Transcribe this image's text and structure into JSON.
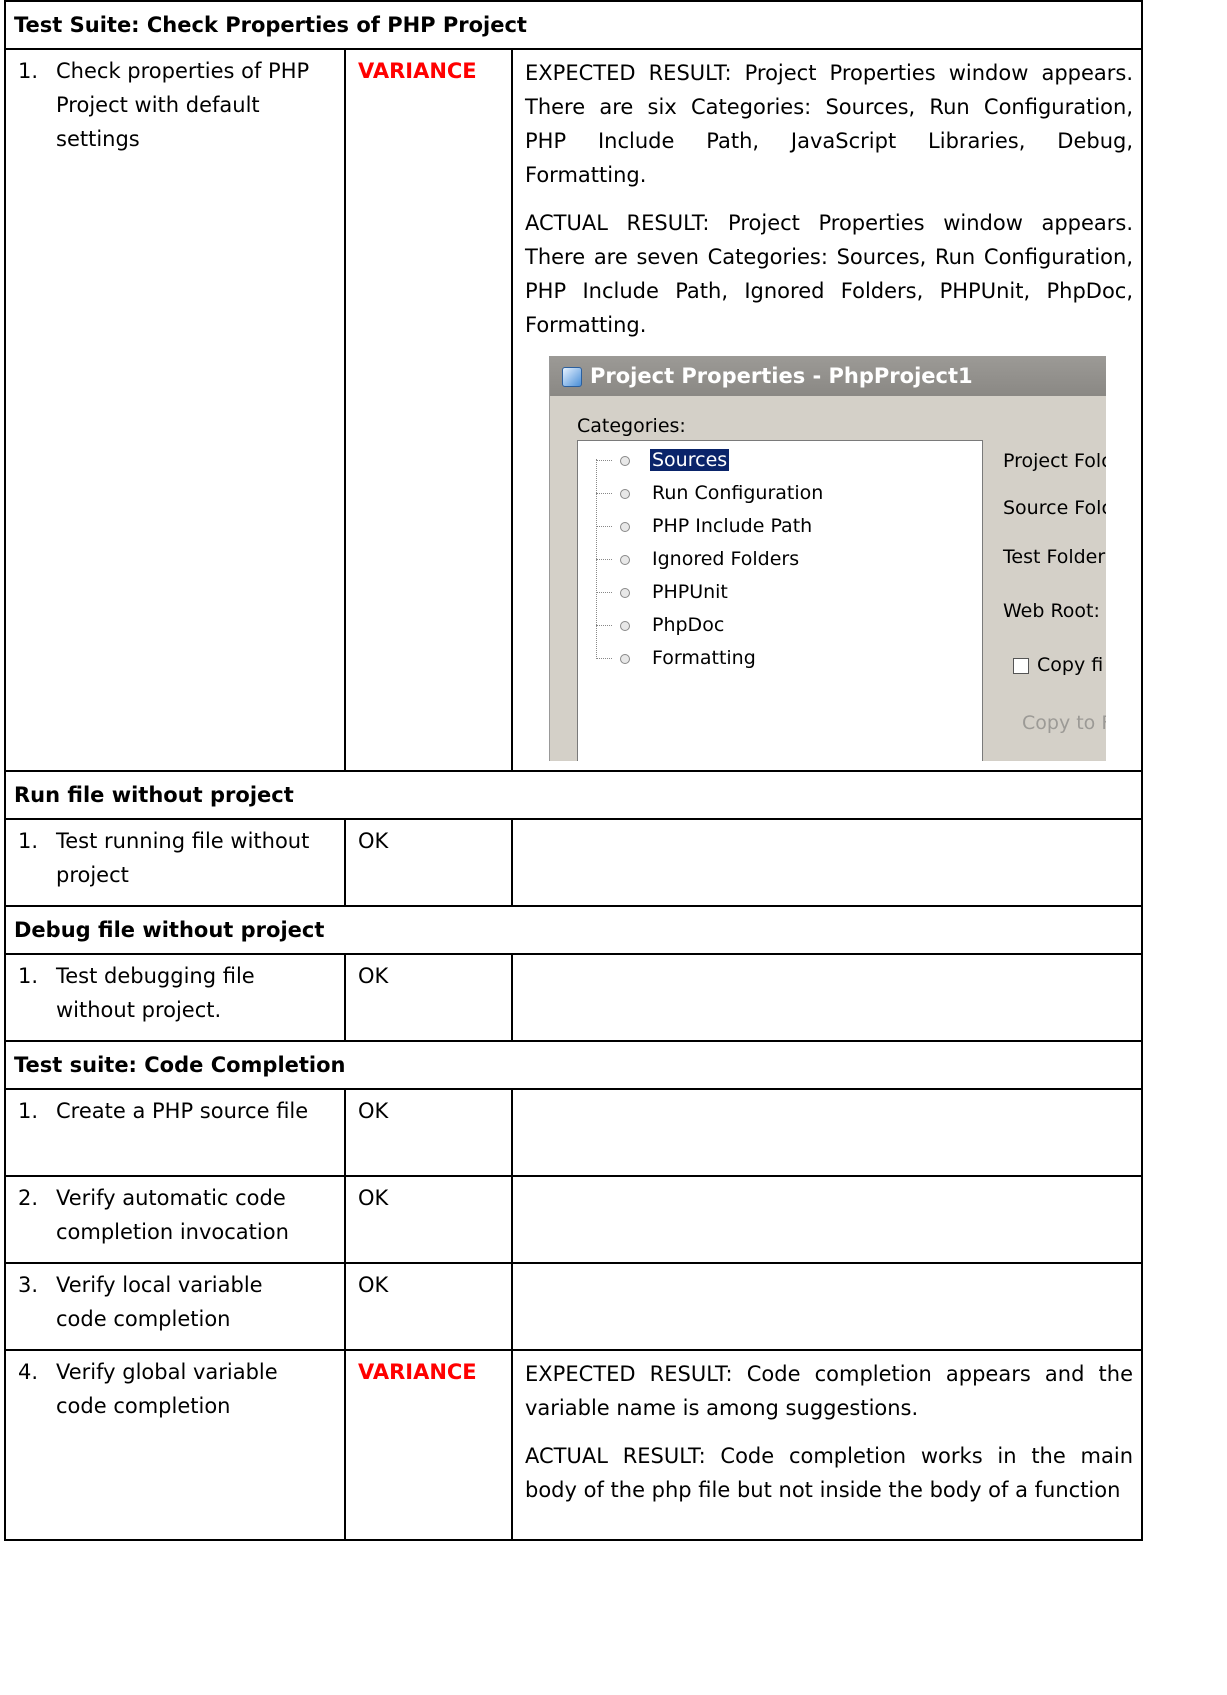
{
  "sections": [
    {
      "title": "Test Suite: Check Properties of PHP Project",
      "rows": [
        {
          "num": "1.",
          "step": "Check properties of PHP Project with default settings",
          "status": "VARIANCE",
          "paragraphs": [
            "EXPECTED RESULT: Project Properties window appears. There are six Categories: Sources, Run Configuration, PHP Include Path, JavaScript Libraries, Debug, Formatting.",
            "ACTUAL RESULT: Project Properties window appears. There are seven Categories: Sources, Run Configuration, PHP Include Path, Ignored Folders, PHPUnit, PhpDoc, Formatting."
          ]
        }
      ]
    },
    {
      "title": "Run file without project",
      "rows": [
        {
          "num": "1.",
          "step": "Test running file without project",
          "status": "OK"
        }
      ]
    },
    {
      "title": "Debug file without project",
      "rows": [
        {
          "num": "1.",
          "step": "Test debugging file without project.",
          "status": "OK"
        }
      ]
    },
    {
      "title": "Test suite: Code Completion",
      "rows": [
        {
          "num": "1.",
          "step": "Create a PHP source file",
          "status": "OK"
        },
        {
          "num": "2.",
          "step": "Verify automatic code completion invocation",
          "status": "OK"
        },
        {
          "num": "3.",
          "step": "Verify local variable code completion",
          "status": "OK"
        },
        {
          "num": "4.",
          "step": "Verify global variable code completion",
          "status": "VARIANCE",
          "paragraphs": [
            "EXPECTED RESULT: Code completion appears and the variable name is among suggestions.",
            "ACTUAL RESULT: Code completion works in the main body of the php file but not inside the body of a function"
          ]
        }
      ]
    }
  ],
  "dialog": {
    "title": "Project Properties - PhpProject1",
    "categories_label": "Categories:",
    "categories": [
      "Sources",
      "Run Configuration",
      "PHP Include Path",
      "Ignored Folders",
      "PHPUnit",
      "PhpDoc",
      "Formatting"
    ],
    "selected": "Sources",
    "right_labels": {
      "project_folder": "Project Folc",
      "source_folder": "Source Folc",
      "test_folder": "Test Folder",
      "web_root": "Web Root:",
      "copy_checkbox": "Copy fi",
      "copy_to": "Copy to F"
    }
  },
  "colors": {
    "variance": "#ff0000",
    "selection": "#0a246a",
    "dialog_bg": "#d4d0c8"
  }
}
